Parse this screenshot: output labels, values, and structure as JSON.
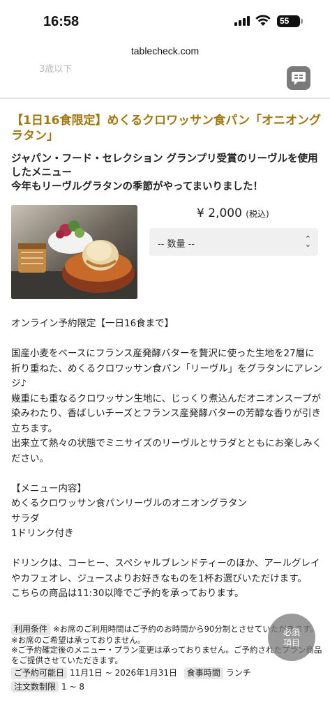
{
  "status_bar": {
    "time": "16:58",
    "battery": "55"
  },
  "browser": {
    "url": "tablecheck.com"
  },
  "ghost_text": "3歳以下",
  "product": {
    "title": "【1日16食限定】めくるクロワッサン食パン「オニオングラタン」",
    "subtitle_lines": [
      "ジャパン・フード・セレクション グランプリ受賞のリーヴルを使用したメニュー",
      "今年もリーヴルグラタンの季節がやってまいりました！"
    ],
    "price": "¥ 2,000",
    "price_note": "(税込)",
    "quantity_placeholder": "-- 数量 --"
  },
  "description": [
    "オンライン予約限定【一日16食まで】",
    "",
    "国産小麦をベースにフランス産発酵バターを贅沢に使った生地を27層に折り重ねた、めくるクロワッサン食パン「リーヴル」をグラタンにアレンジ♪",
    "幾重にも重なるクロワッサン生地に、じっくり煮込んだオニオンスープが染みわたり、香ばしいチーズとフランス産発酵バターの芳醇な香りが引き立ちます。",
    "出来立て熱々の状態でミニサイズのリーヴルとサラダとともにお楽しみください。",
    "",
    "【メニュー内容】",
    "めくるクロワッサン食パンリーヴルのオニオングラタン",
    "サラダ",
    "1ドリンク付き",
    "",
    "ドリンクは、コーヒー、スペシャルブレンドティーのほか、アールグレイやカフェオレ、ジュースよりお好きなものを1杯お選びいただけます。",
    "こちらの商品は11:30以降でご予約を承っております。"
  ],
  "conditions": {
    "usage_label": "利用条件",
    "usage_notes": [
      "※お席のご利用時間はご予約のお時間から90分制とさせていただきます。",
      "※お席のご希望は承っておりません。",
      "※ご予約確定後のメニュー・プラン変更は承っておりません。ご予約されたプラン商品をご提供させていただきます。"
    ],
    "period_label": "ご予約可能日",
    "period_value": "11月1日 ~ 2026年1月31日",
    "meal_label": "食事時間",
    "meal_value": "ランチ",
    "order_label": "注文数制限",
    "order_value": "1 ~ 8"
  },
  "required_badge": {
    "line1": "必須",
    "line2": "項目"
  },
  "icons": {
    "chat": "chat-icon",
    "signal": "signal-icon",
    "wifi": "wifi-icon",
    "chevron": "updown-chevron-icon"
  }
}
